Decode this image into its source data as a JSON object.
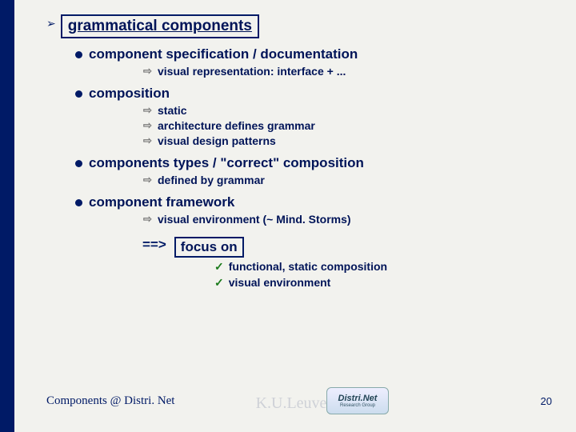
{
  "heading": "grammatical components",
  "items": [
    {
      "label": "component specification / documentation",
      "subs": [
        "visual representation: interface + ..."
      ]
    },
    {
      "label": "composition",
      "subs": [
        "static",
        "architecture defines grammar",
        "visual design patterns"
      ]
    },
    {
      "label": "components types / \"correct\" composition",
      "subs": [
        "defined by grammar"
      ]
    },
    {
      "label": "component framework",
      "subs": [
        "visual environment (~ Mind. Storms)"
      ]
    }
  ],
  "focusArrow": "==>",
  "focus": {
    "label": "focus on",
    "subs": [
      "functional, static composition",
      "visual environment"
    ]
  },
  "footer": {
    "left": "Components @ Distri. Net",
    "logo_name": "Distri.Net",
    "logo_sub": "Research Group",
    "page": "20"
  },
  "watermark": "K.U.Leuven"
}
